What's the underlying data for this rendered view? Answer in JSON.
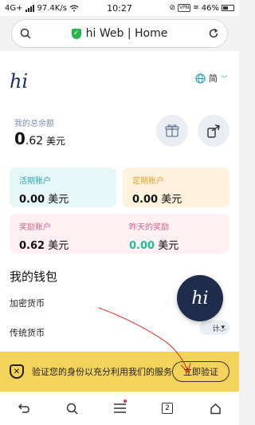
{
  "status_bar": {
    "network": "4G+",
    "speed": "97.4K/s",
    "time": "10:27",
    "vpn": "VPN",
    "battery": "46%"
  },
  "url_bar": {
    "url_text": "hi Web | Home",
    "search_icon": "search-icon",
    "secure_icon": "shield-check-icon",
    "reload_icon": "reload-icon"
  },
  "header": {
    "logo": "hi",
    "language": "简"
  },
  "balance": {
    "label": "我的总余额",
    "int_part": "0",
    "dec_part": ".62",
    "currency": "美元"
  },
  "accounts": {
    "current": {
      "label": "活期账户",
      "value": "0.00",
      "unit": "美元"
    },
    "fixed": {
      "label": "定期账户",
      "value": "0.00",
      "unit": "美元"
    },
    "reward": {
      "label": "奖励账户",
      "value": "0.62",
      "unit": "美元"
    },
    "yesterday": {
      "label": "昨天的奖励",
      "value": "0.00",
      "unit": "美元"
    }
  },
  "wallet": {
    "title": "我的钱包",
    "items": [
      {
        "label": "加密货币"
      },
      {
        "label": "传统货币"
      }
    ],
    "tag_stub": "计"
  },
  "verify_banner": {
    "text": "验证您的身份以充分利用我们的服务",
    "button": "立即验证"
  },
  "bottom_nav": {
    "tabs_count": "2"
  },
  "colors": {
    "brand_navy": "#1f2d4d",
    "accent_blue": "#2aa7b5",
    "accent_orange": "#e0a030",
    "accent_pink": "#d0658c",
    "accent_green": "#1bbf9b",
    "banner_yellow": "#f4d35a",
    "annotation_red": "#e02020"
  }
}
